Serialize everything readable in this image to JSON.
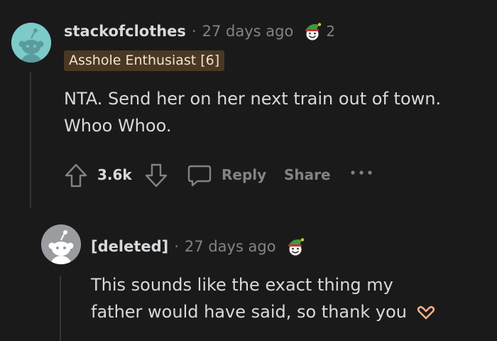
{
  "comment": {
    "username": "stackofclothes",
    "separator": "·",
    "timestamp": "27 days ago",
    "award_icon": "elf-hat-award-icon",
    "award_count": "2",
    "flair": "Asshole Enthusiast [6]",
    "body_line1": "NTA. Send her on her next train out of town.",
    "body_line2": "Whoo Whoo.",
    "vote_count": "3.6k",
    "reply_label": "Reply",
    "share_label": "Share",
    "more_icon": "ellipsis-icon"
  },
  "reply": {
    "username": "[deleted]",
    "separator": "·",
    "timestamp": "27 days ago",
    "award_icon": "elf-hat-award-icon",
    "body_line1": "This sounds like the exact thing my",
    "body_line2": "father would have said, so thank you",
    "emoji_icon": "heart-hands-icon"
  },
  "colors": {
    "background": "#1a1a1b",
    "text": "#d7dadc",
    "meta": "#818384",
    "flair_bg": "#4a3823",
    "avatar_teal": "#7ccac9",
    "avatar_gray": "#9a9c9f"
  }
}
